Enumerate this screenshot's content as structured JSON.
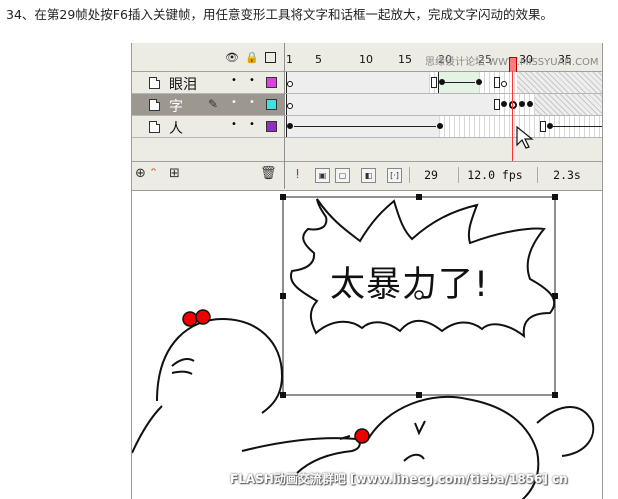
{
  "instruction": "34、在第29帧处按F6插入关键帧，用任意变形工具将文字和话框一起放大，完成文字闪动的效果。",
  "timeline": {
    "header_icons": [
      "eye-icon",
      "lock-icon",
      "outline-icon"
    ],
    "ruler_labels": [
      "1",
      "5",
      "10",
      "15",
      "20",
      "25",
      "30",
      "35"
    ],
    "watermark": "思缘设计论坛  WWW.MISSYUAN.COM",
    "layers": [
      {
        "name": "眼泪",
        "selected": false,
        "swatch": "#e040e0",
        "dot1": "•",
        "dot2": "•"
      },
      {
        "name": "字",
        "selected": true,
        "swatch": "#40e0e0",
        "dot1": "•",
        "dot2": "•"
      },
      {
        "name": "人",
        "selected": false,
        "swatch": "#9030c0",
        "dot1": "•",
        "dot2": "•"
      }
    ],
    "toolbar_icons": [
      "add-layer-icon",
      "add-guide-icon",
      "add-folder-icon",
      "trash-icon"
    ],
    "status": {
      "current_frame": "29",
      "fps": "12.0 fps",
      "elapsed": "2.3s"
    }
  },
  "stage": {
    "bubble_text": "太暴力了!"
  },
  "footer_watermark": "FLASH动画交流群吧  [www.linecg.com/tieba/1856]  cn"
}
